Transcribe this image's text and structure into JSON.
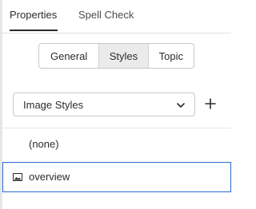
{
  "tabs": [
    {
      "label": "Properties",
      "active": true
    },
    {
      "label": "Spell Check",
      "active": false
    }
  ],
  "segments": [
    {
      "label": "General",
      "selected": false
    },
    {
      "label": "Styles",
      "selected": true
    },
    {
      "label": "Topic",
      "selected": false
    }
  ],
  "dropdown": {
    "value": "Image Styles",
    "icon": "chevron-down-icon"
  },
  "add_button": {
    "icon": "plus-icon"
  },
  "style_list": [
    {
      "label": "(none)",
      "icon": null,
      "selected": false
    },
    {
      "label": "overview",
      "icon": "image-icon",
      "selected": true
    }
  ],
  "colors": {
    "accent": "#2a6bd1",
    "selected_segment": "#ebebeb"
  }
}
